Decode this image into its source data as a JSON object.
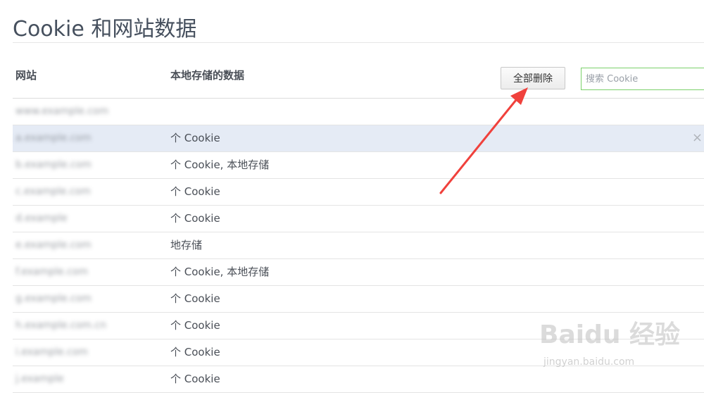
{
  "page": {
    "title": "Cookie 和网站数据"
  },
  "columns": {
    "site": "网站",
    "data": "本地存储的数据"
  },
  "toolbar": {
    "remove_all_label": "全部删除",
    "search_placeholder": "搜索 Cookie"
  },
  "rows": [
    {
      "site": "www.example.com",
      "desc": ""
    },
    {
      "site": "a.example.com",
      "desc": "个 Cookie",
      "selected": true
    },
    {
      "site": "b.example.com",
      "desc": "个 Cookie, 本地存储"
    },
    {
      "site": "c.example.com",
      "desc": "个 Cookie"
    },
    {
      "site": "d.example",
      "desc": "个 Cookie"
    },
    {
      "site": "e.example.com",
      "desc": "地存储"
    },
    {
      "site": "f.example.com",
      "desc": "个 Cookie, 本地存储"
    },
    {
      "site": "g.example.com",
      "desc": "个 Cookie"
    },
    {
      "site": "h.example.com.cn",
      "desc": "个 Cookie"
    },
    {
      "site": "i.example.com",
      "desc": "个 Cookie"
    },
    {
      "site": "j.example",
      "desc": "个 Cookie"
    }
  ],
  "row_remove_glyph": "×",
  "watermark": {
    "brand": "Baidu 经验",
    "url": "jingyan.baidu.com"
  },
  "colors": {
    "accent_arrow": "#f0413c",
    "selected_row": "#e5ebf5",
    "search_border": "#7bd16a"
  }
}
